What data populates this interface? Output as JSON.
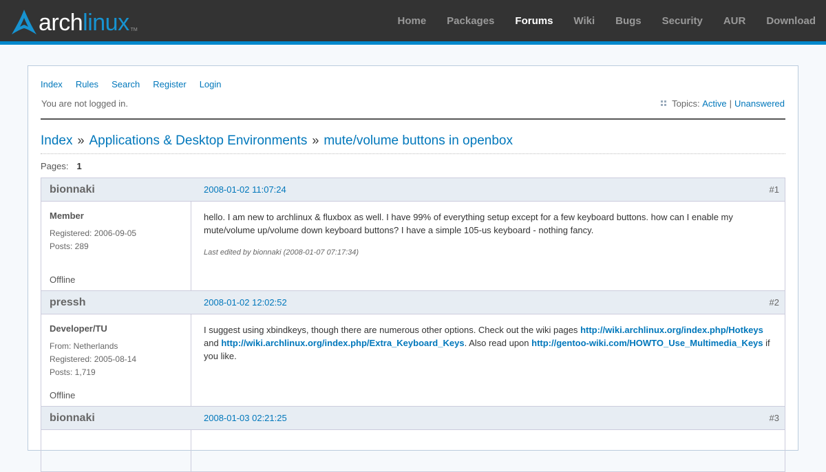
{
  "header": {
    "logo": {
      "arch": "arch",
      "linux": "linux",
      "tm": "TM"
    },
    "nav": [
      {
        "label": "Home",
        "active": false
      },
      {
        "label": "Packages",
        "active": false
      },
      {
        "label": "Forums",
        "active": true
      },
      {
        "label": "Wiki",
        "active": false
      },
      {
        "label": "Bugs",
        "active": false
      },
      {
        "label": "Security",
        "active": false
      },
      {
        "label": "AUR",
        "active": false
      },
      {
        "label": "Download",
        "active": false
      }
    ]
  },
  "subnav": [
    "Index",
    "Rules",
    "Search",
    "Register",
    "Login"
  ],
  "status": {
    "login_text": "You are not logged in.",
    "topics_label": "Topics:",
    "active_link": "Active",
    "separator": "|",
    "unanswered_link": "Unanswered"
  },
  "breadcrumb": {
    "items": [
      "Index",
      "Applications & Desktop Environments",
      "mute/volume buttons in openbox"
    ],
    "separator": "»"
  },
  "pages": {
    "label": "Pages:",
    "current": "1"
  },
  "posts": [
    {
      "author": "bionnaki",
      "date": "2008-01-02 11:07:24",
      "number": "#1",
      "role": "Member",
      "meta": [
        "Registered: 2006-09-05",
        "Posts: 289"
      ],
      "status": "Offline",
      "text": "hello. I am new to archlinux & fluxbox as well. I have 99% of everything setup except for a few keyboard buttons. how can I enable my mute/volume up/volume down keyboard buttons? I have a simple 105-us keyboard - nothing fancy.",
      "edited": "Last edited by bionnaki (2008-01-07 07:17:34)"
    },
    {
      "author": "pressh",
      "date": "2008-01-02 12:02:52",
      "number": "#2",
      "role": "Developer/TU",
      "meta": [
        "From: Netherlands",
        "Registered: 2005-08-14",
        "Posts: 1,719"
      ],
      "status": "Offline",
      "text_parts": {
        "t1": "I suggest using xbindkeys, though there are numerous other options. Check out the wiki pages ",
        "link1": "http://wiki.archlinux.org/index.php/Hotkeys",
        "t2": " and ",
        "link2": "http://wiki.archlinux.org/index.php/Extra_Keyboard_Keys",
        "t3": ". Also read upon ",
        "link3": "http://gentoo-wiki.com/HOWTO_Use_Multimedia_Keys",
        "t4": " if you like."
      }
    },
    {
      "author": "bionnaki",
      "date": "2008-01-03 02:21:25",
      "number": "#3"
    }
  ],
  "colors": {
    "accent": "#08c",
    "link": "#07b",
    "header_bg": "#333"
  }
}
